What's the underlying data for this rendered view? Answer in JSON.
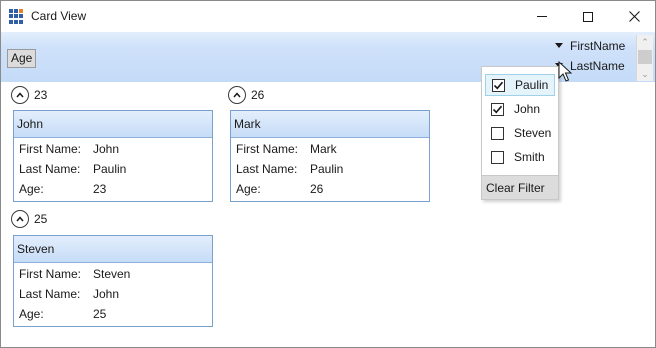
{
  "window": {
    "title": "Card View"
  },
  "group_panel": {
    "group_field": "Age"
  },
  "sort_list": {
    "items": [
      "FirstName",
      "LastName"
    ]
  },
  "groups": [
    {
      "value": "23",
      "cards": [
        {
          "header": "John",
          "fields": [
            {
              "label": "First Name:",
              "value": "John"
            },
            {
              "label": "Last Name:",
              "value": "Paulin"
            },
            {
              "label": "Age:",
              "value": "23"
            }
          ]
        }
      ]
    },
    {
      "value": "26",
      "cards": [
        {
          "header": "Mark",
          "fields": [
            {
              "label": "First Name:",
              "value": "Mark"
            },
            {
              "label": "Last Name:",
              "value": "Paulin"
            },
            {
              "label": "Age:",
              "value": "26"
            }
          ]
        }
      ]
    },
    {
      "value": "25",
      "cards": [
        {
          "header": "Steven",
          "fields": [
            {
              "label": "First Name:",
              "value": "Steven"
            },
            {
              "label": "Last Name:",
              "value": "John"
            },
            {
              "label": "Age:",
              "value": "25"
            }
          ]
        }
      ]
    }
  ],
  "filter_popup": {
    "items": [
      {
        "label": "Paulin",
        "checked": true
      },
      {
        "label": "John",
        "checked": true
      },
      {
        "label": "Steven",
        "checked": false
      },
      {
        "label": "Smith",
        "checked": false
      }
    ],
    "clear_label": "Clear Filter"
  }
}
